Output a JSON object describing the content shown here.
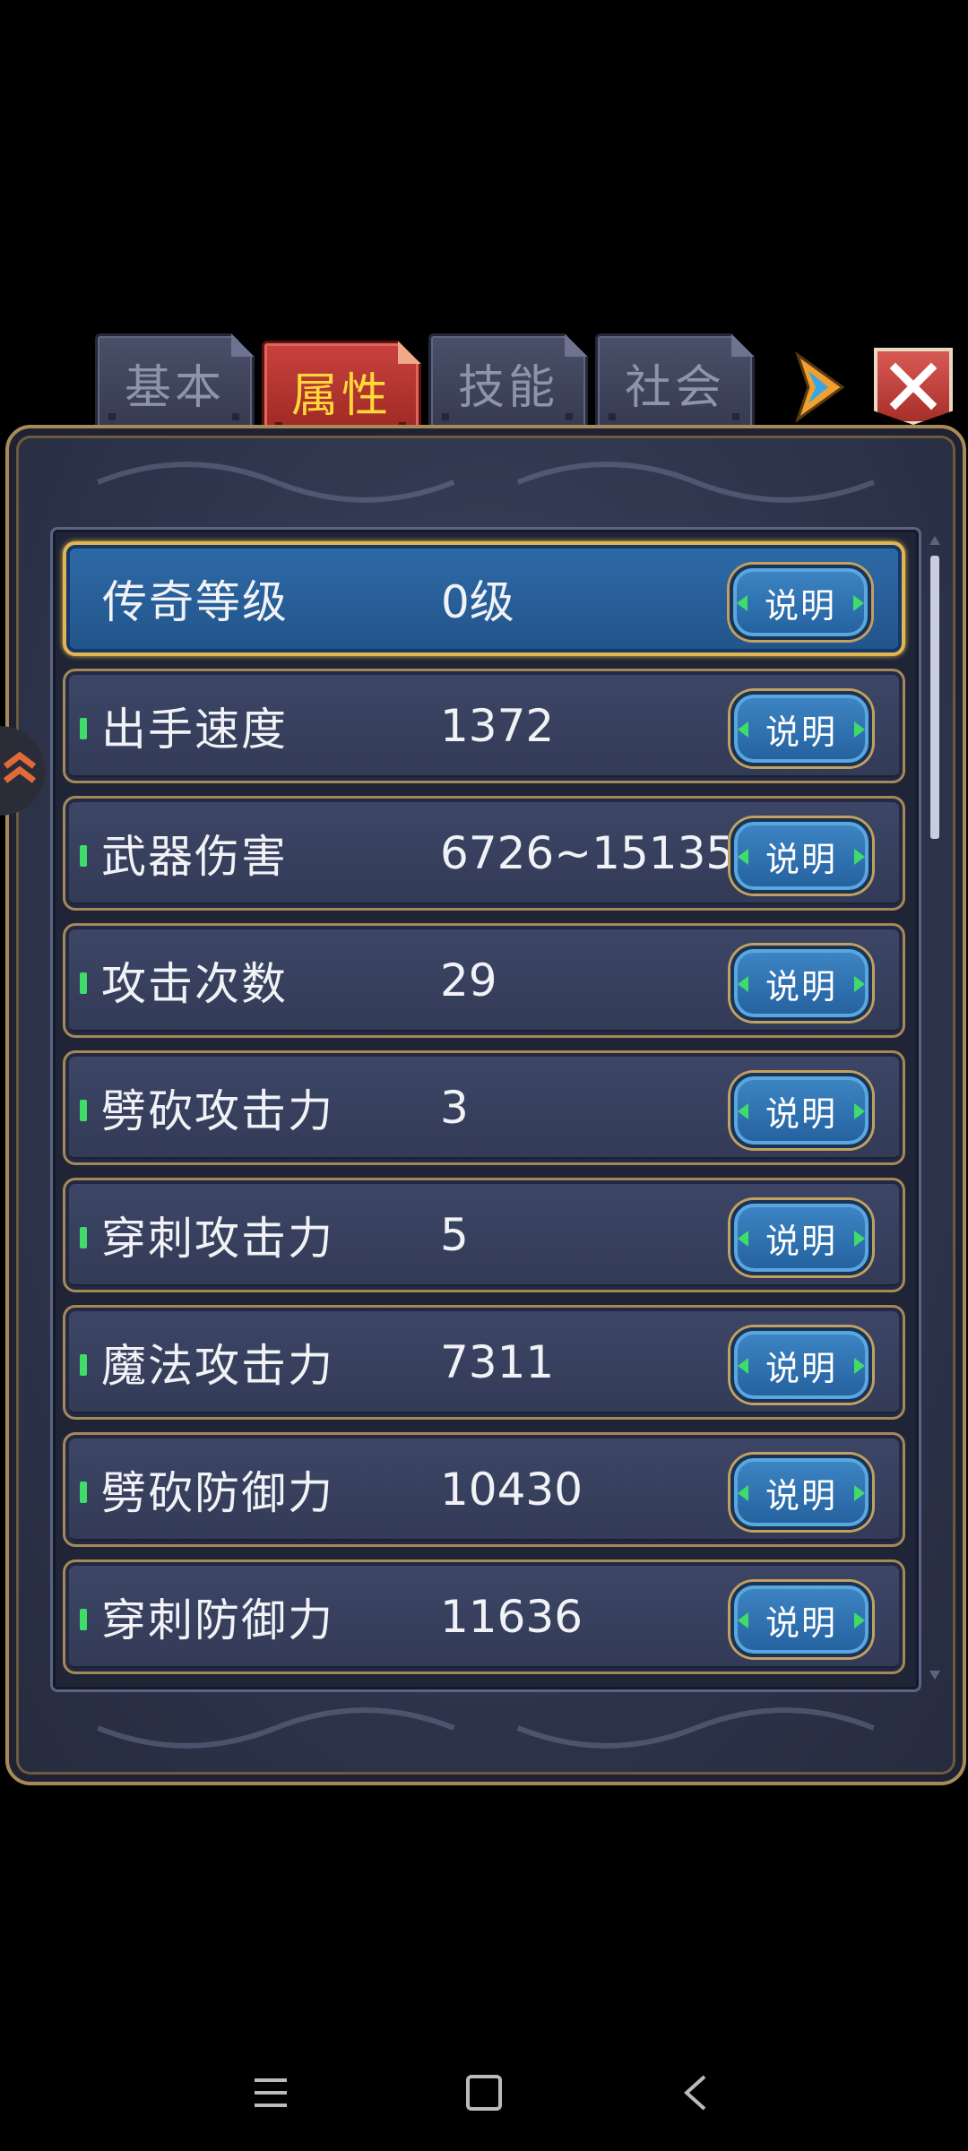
{
  "tabs": [
    {
      "label": "基本",
      "active": false
    },
    {
      "label": "属性",
      "active": true
    },
    {
      "label": "技能",
      "active": false
    },
    {
      "label": "社会",
      "active": false
    }
  ],
  "rows": [
    {
      "label": "传奇等级",
      "value": "0级",
      "button": "说明"
    },
    {
      "label": "出手速度",
      "value": "1372",
      "button": "说明"
    },
    {
      "label": "武器伤害",
      "value": "6726~15135",
      "button": "说明"
    },
    {
      "label": "攻击次数",
      "value": "29",
      "button": "说明"
    },
    {
      "label": "劈砍攻击力",
      "value": "3",
      "button": "说明"
    },
    {
      "label": "穿刺攻击力",
      "value": "5",
      "button": "说明"
    },
    {
      "label": "魔法攻击力",
      "value": "7311",
      "button": "说明"
    },
    {
      "label": "劈砍防御力",
      "value": "10430",
      "button": "说明"
    },
    {
      "label": "穿刺防御力",
      "value": "11636",
      "button": "说明"
    }
  ],
  "icons": {
    "close": "close-icon",
    "next": "arrow-right-icon",
    "side": "chevron-left-icon",
    "nav_menu": "menu-icon",
    "nav_home": "home-icon",
    "nav_back": "back-icon"
  },
  "colors": {
    "active_tab": "#c0392b",
    "active_tab_text": "#ffd83a",
    "highlight_row": "#2e6aa8",
    "gold_border": "#a58858"
  }
}
